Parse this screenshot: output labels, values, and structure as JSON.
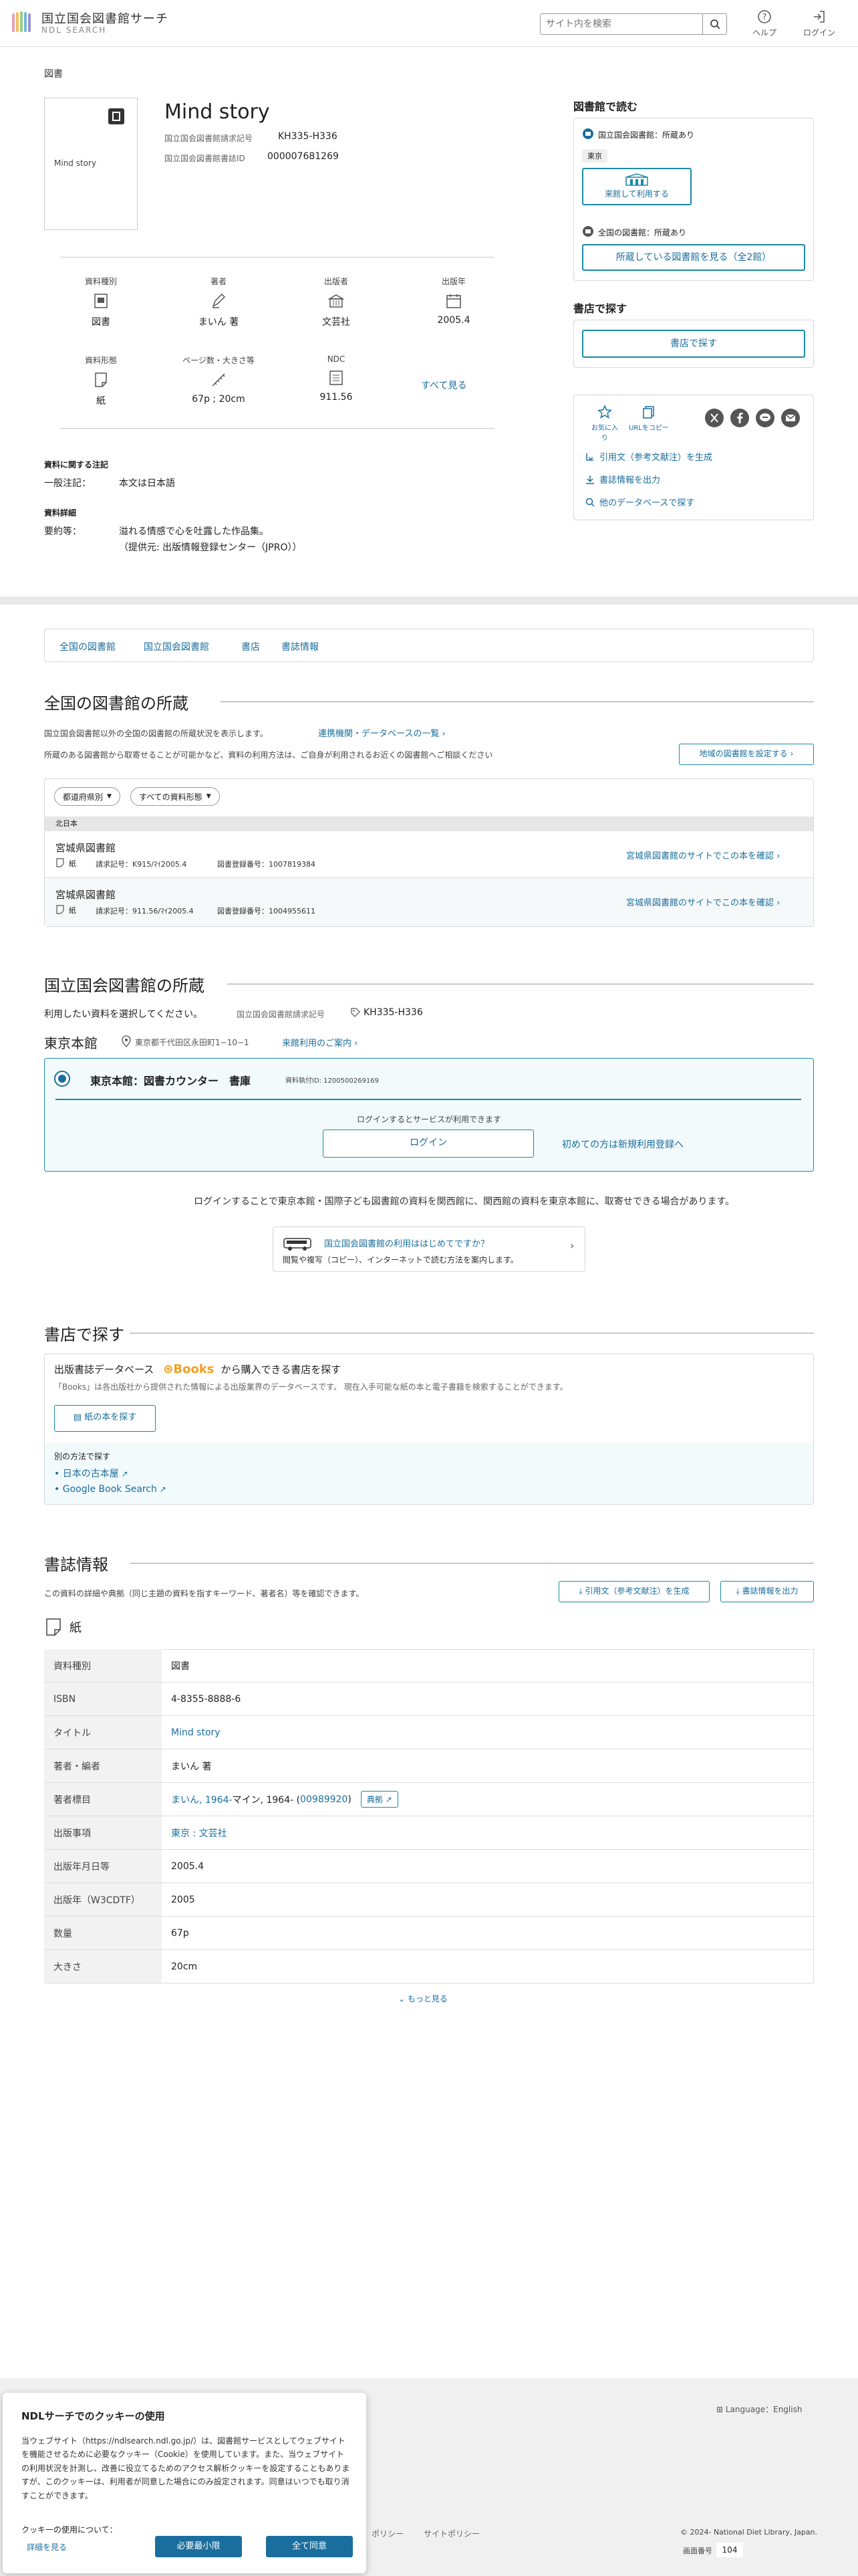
{
  "header": {
    "logo_title": "国立国会図書館サーチ",
    "logo_sub": "NDL SEARCH",
    "search_placeholder": "サイト内を検索",
    "help": "ヘルプ",
    "login": "ログイン"
  },
  "item": {
    "category_label": "図書",
    "thumb_title": "Mind story",
    "title": "Mind story",
    "call_label": "国立国会図書館請求記号",
    "call_value": "KH335-H336",
    "book_id_label": "国立国会図書館書誌ID",
    "book_id_value": "000007681269"
  },
  "attrs": [
    {
      "label": "資料種別",
      "value": "図書"
    },
    {
      "label": "著者",
      "value": "まいん 著"
    },
    {
      "label": "出版者",
      "value": "文芸社"
    },
    {
      "label": "出版年",
      "value": "2005.4"
    },
    {
      "label": "資料形態",
      "value": "紙"
    },
    {
      "label": "ページ数・大きさ等",
      "value": "67p ; 20cm"
    },
    {
      "label": "NDC",
      "value": "911.56"
    }
  ],
  "see_all": "すべて見る",
  "notes": {
    "heading": "資料に関する注記",
    "general_key": "一般注記：",
    "general_val": "本文は日本語",
    "detail_heading": "資料詳細",
    "summary_key": "要約等：",
    "summary_val1": "溢れる情感で心を吐露した作品集。",
    "summary_val2": "（提供元: 出版情報登録センター（JPRO））"
  },
  "right": {
    "read_heading": "図書館で読む",
    "ndl_holds": "国立国会図書館：所蔵あり",
    "tokyo_badge": "東京",
    "visit_button": "来館して利用する",
    "all_holds": "全国の図書館：所蔵あり",
    "see_libraries": "所蔵している図書館を見る（全2館）",
    "shop_heading": "書店で探す",
    "shop_button": "書店で探す",
    "fav": "お気に入り",
    "copy_url": "URLをコピー",
    "cite": "引用文（参考文献注）を生成",
    "export": "書誌情報を出力",
    "other_db": "他のデータベースで探す"
  },
  "tabs": [
    "全国の図書館",
    "国立国会図書館",
    "書店",
    "書誌情報"
  ],
  "national": {
    "heading": "全国の図書館の所蔵",
    "desc1": "国立国会図書館以外の全国の図書館の所蔵状況を表示します。",
    "coop_link": "連携機関・データベースの一覧",
    "desc2": "所蔵のある図書館から取寄せることが可能かなど、資料の利用方法は、ご自身が利用されるお近くの図書館へご相談ください",
    "region_button": "地域の図書館を設定する",
    "filter1": "都道府県別",
    "filter2": "すべての資料形態",
    "region": "北日本",
    "libraries": [
      {
        "name": "宮城県図書館",
        "type": "紙",
        "call": "請求記号：K915/ﾏｲ2005.4",
        "reg": "図書登録番号：1007819384",
        "link": "宮城県図書館のサイトでこの本を確認"
      },
      {
        "name": "宮城県図書館",
        "type": "紙",
        "call": "請求記号：911.56/ﾏｲ2005.4",
        "reg": "図書登録番号：1004955611",
        "link": "宮城県図書館のサイトでこの本を確認"
      }
    ]
  },
  "ndl": {
    "heading": "国立国会図書館の所蔵",
    "select_text": "利用したい資料を選択してください。",
    "call_label": "国立国会図書館請求記号",
    "call_value": "KH335-H336",
    "branch": "東京本館",
    "address": "東京都千代田区永田町1−10−1",
    "guide_link": "来館利用のご案内",
    "counter": "東京本館：図書カウンター　書庫",
    "reg_id": "資料執付ID: 1200500269169",
    "login_note": "ログインするとサービスが利用できます",
    "login_button": "ログイン",
    "register_link": "初めての方は新規利用登録へ",
    "bottom_note": "ログインすることで東京本館・国際子ども図書館の資料を関西館に、関西館の資料を東京本館に、取寄せできる場合があります。",
    "first_time_title": "国立国会図書館の利用ははじめてですか？",
    "first_time_desc": "閲覧や複写（コピー）、インターネットで読む方法を案内します。"
  },
  "bookstore": {
    "heading": "書店で探す",
    "db_title_a": "出版書誌データベース",
    "db_brand": "Books",
    "db_title_b": "から購入できる書店を探す",
    "db_desc": "「Books」は各出版社から提供された情報による出版業界のデータベースです。 現在入手可能な紙の本と電子書籍を検索することができます。",
    "paper_button": "紙の本を探す",
    "other_heading": "別の方法で探す",
    "link1": "日本の古本屋",
    "link2": "Google Book Search"
  },
  "biblio": {
    "heading": "書誌情報",
    "desc": "この資料の詳細や典拠（同じ主題の資料を指すキーワード、著者名）等を確認できます。",
    "cite_button": "引用文（参考文献注）を生成",
    "export_button": "書誌情報を出力",
    "form": "紙",
    "rows": [
      {
        "k": "資料種別",
        "v": "図書"
      },
      {
        "k": "ISBN",
        "v": "4-8355-8888-6"
      },
      {
        "k": "タイトル",
        "v": "Mind story"
      },
      {
        "k": "著者・編者",
        "v": "まいん 著"
      },
      {
        "k": "著者標目",
        "v": ""
      },
      {
        "k": "出版事項",
        "v": "東京 : 文芸社"
      },
      {
        "k": "出版年月日等",
        "v": "2005.4"
      },
      {
        "k": "出版年（W3CDTF）",
        "v": "2005"
      },
      {
        "k": "数量",
        "v": "67p"
      },
      {
        "k": "大きさ",
        "v": "20cm"
      }
    ],
    "author_link1": "まいん, 1964-",
    "author_mid": " マイン, 1964- (",
    "author_link2": "00989920",
    "author_end": ")",
    "tenkyo": "典拠",
    "more": "もっと見る"
  },
  "footer": {
    "language": "Language：English",
    "policy_a": "ポリシー",
    "policy_b": "サイトポリシー",
    "copyright": "© 2024- National Diet Library, Japan.",
    "screen_no_label": "画面番号",
    "screen_no": "104"
  },
  "cookie": {
    "title": "NDLサーチでのクッキーの使用",
    "body": "当ウェブサイト（https://ndlsearch.ndl.go.jp/）は、図書館サービスとしてウェブサイトを機能させるために必要なクッキー（Cookie）を使用しています。また、当ウェブサイトの利用状況を計測し、改善に役立てるためのアクセス解析クッキーを設定することもありますが、このクッキーは、利用者が同意した場合にのみ設定されます。同意はいつでも取り消すことができます。",
    "about": "クッキーの使用について：",
    "details": "詳細を見る",
    "necessary": "必要最小限",
    "agree": "全て同意"
  },
  "colors": {
    "accent": "#1a8aa8",
    "link": "#1a6e9e",
    "brand_orange": "#f0a020"
  }
}
